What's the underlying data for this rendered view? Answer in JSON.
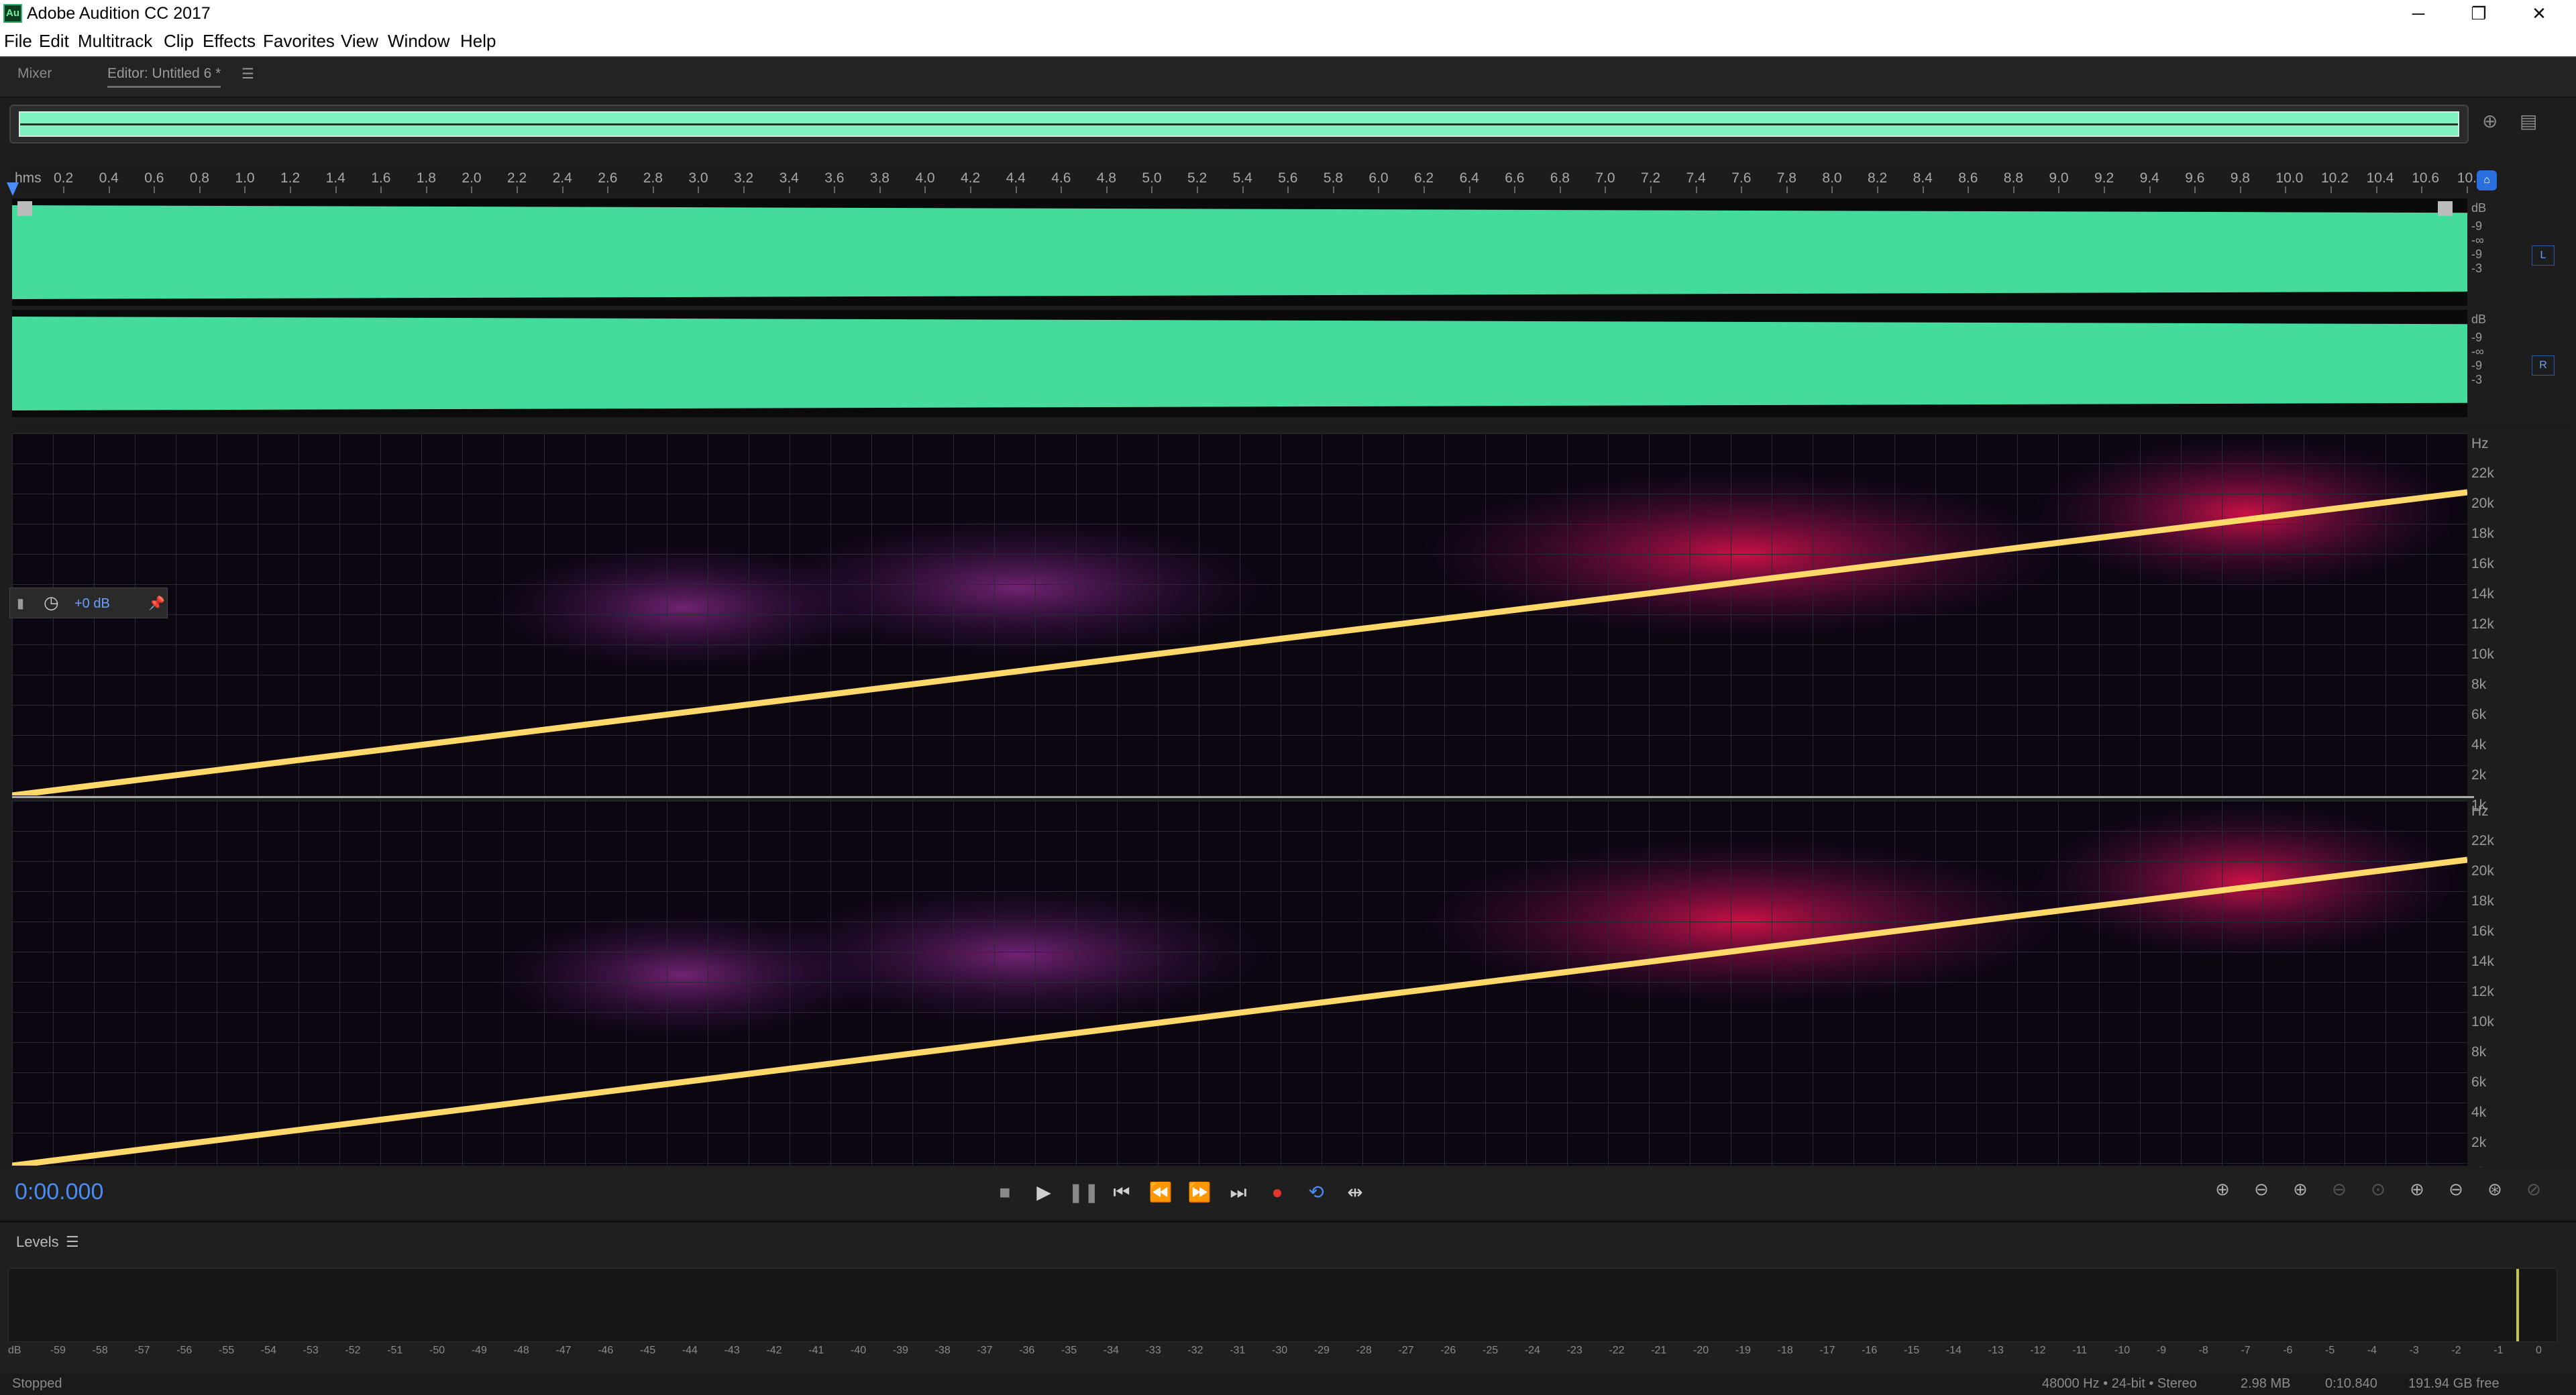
{
  "window": {
    "title": "Adobe Audition CC 2017",
    "app_icon": "Au"
  },
  "menu": [
    "File",
    "Edit",
    "Multitrack",
    "Clip",
    "Effects",
    "Favorites",
    "View",
    "Window",
    "Help"
  ],
  "tabs": {
    "mixer": "Mixer",
    "editor": "Editor: Untitled 6 *"
  },
  "ruler": {
    "unit": "hms",
    "labels": [
      "0.2",
      "0.4",
      "0.6",
      "0.8",
      "1.0",
      "1.2",
      "1.4",
      "1.6",
      "1.8",
      "2.0",
      "2.2",
      "2.4",
      "2.6",
      "2.8",
      "3.0",
      "3.2",
      "3.4",
      "3.6",
      "3.8",
      "4.0",
      "4.2",
      "4.4",
      "4.6",
      "4.8",
      "5.0",
      "5.2",
      "5.4",
      "5.6",
      "5.8",
      "6.0",
      "6.2",
      "6.4",
      "6.6",
      "6.8",
      "7.0",
      "7.2",
      "7.4",
      "7.6",
      "7.8",
      "8.0",
      "8.2",
      "8.4",
      "8.6",
      "8.8",
      "9.0",
      "9.2",
      "9.4",
      "9.6",
      "9.8",
      "10.0",
      "10.2",
      "10.4",
      "10.6",
      "10."
    ]
  },
  "db_scale": {
    "unit": "dB",
    "values": [
      "-9",
      "-∞",
      "-9",
      "-3"
    ]
  },
  "channels": {
    "left": "L",
    "right": "R"
  },
  "hz_scale": {
    "unit": "Hz",
    "values": [
      "22k",
      "20k",
      "18k",
      "16k",
      "14k",
      "12k",
      "10k",
      "8k",
      "6k",
      "4k",
      "2k",
      "1k"
    ]
  },
  "hud": {
    "gain": "+0 dB"
  },
  "transport": {
    "time": "0:00.000"
  },
  "levels": {
    "title": "Levels",
    "scale": [
      "dB",
      "-59",
      "-58",
      "-57",
      "-56",
      "-55",
      "-54",
      "-53",
      "-52",
      "-51",
      "-50",
      "-49",
      "-48",
      "-47",
      "-46",
      "-45",
      "-44",
      "-43",
      "-42",
      "-41",
      "-40",
      "-39",
      "-38",
      "-37",
      "-36",
      "-35",
      "-34",
      "-33",
      "-32",
      "-31",
      "-30",
      "-29",
      "-28",
      "-27",
      "-26",
      "-25",
      "-24",
      "-23",
      "-22",
      "-21",
      "-20",
      "-19",
      "-18",
      "-17",
      "-16",
      "-15",
      "-14",
      "-13",
      "-12",
      "-11",
      "-10",
      "-9",
      "-8",
      "-7",
      "-6",
      "-5",
      "-4",
      "-3",
      "-2",
      "-1",
      "0"
    ]
  },
  "status": {
    "state": "Stopped",
    "format": "48000 Hz • 24-bit • Stereo",
    "size": "2.98 MB",
    "duration": "0:10.840",
    "free": "191.94 GB free"
  },
  "colors": {
    "waveform": "#45db9c",
    "accent": "#4a8cf5",
    "chirp": "#ffd86a"
  }
}
